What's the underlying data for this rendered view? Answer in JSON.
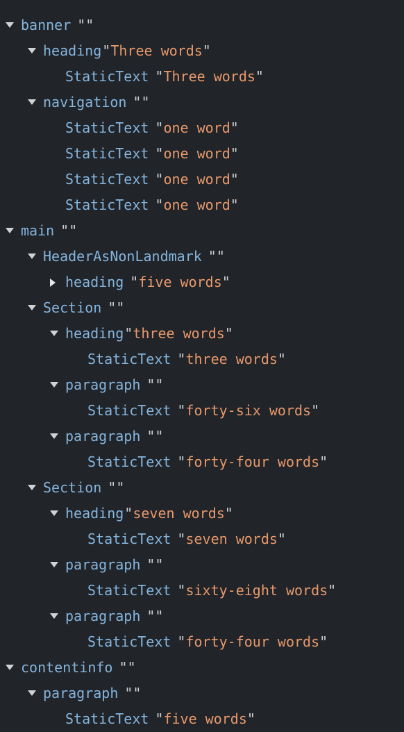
{
  "panel": {
    "name": "accessibility-tree",
    "title": "Accessibility Tree",
    "background_color": "#212429",
    "role_color": "#85b5dd",
    "value_color": "#e8996c",
    "quote_color": "#cdd0d3",
    "triangle_color": "#cfd3d6"
  },
  "quote": "\"",
  "nodes": [
    {
      "depth": 0,
      "marker": "none",
      "role": "",
      "value": "",
      "clipped": true
    },
    {
      "depth": 0,
      "marker": "open",
      "role": "banner",
      "value": ""
    },
    {
      "depth": 1,
      "marker": "open",
      "role": "heading",
      "value": "Three words"
    },
    {
      "depth": 2,
      "marker": "none",
      "role": "StaticText",
      "value": "Three words"
    },
    {
      "depth": 1,
      "marker": "open",
      "role": "navigation",
      "value": ""
    },
    {
      "depth": 2,
      "marker": "none",
      "role": "StaticText",
      "value": "one word"
    },
    {
      "depth": 2,
      "marker": "none",
      "role": "StaticText",
      "value": "one word"
    },
    {
      "depth": 2,
      "marker": "none",
      "role": "StaticText",
      "value": "one word"
    },
    {
      "depth": 2,
      "marker": "none",
      "role": "StaticText",
      "value": "one word"
    },
    {
      "depth": 0,
      "marker": "open",
      "role": "main",
      "value": ""
    },
    {
      "depth": 1,
      "marker": "open",
      "role": "HeaderAsNonLandmark",
      "value": ""
    },
    {
      "depth": 2,
      "marker": "closed",
      "role": "heading",
      "value": "five words"
    },
    {
      "depth": 1,
      "marker": "open",
      "role": "Section",
      "value": ""
    },
    {
      "depth": 2,
      "marker": "open",
      "role": "heading",
      "value": "three words"
    },
    {
      "depth": 3,
      "marker": "none",
      "role": "StaticText",
      "value": "three words"
    },
    {
      "depth": 2,
      "marker": "open",
      "role": "paragraph",
      "value": ""
    },
    {
      "depth": 3,
      "marker": "none",
      "role": "StaticText",
      "value": "forty-six words"
    },
    {
      "depth": 2,
      "marker": "open",
      "role": "paragraph",
      "value": ""
    },
    {
      "depth": 3,
      "marker": "none",
      "role": "StaticText",
      "value": "forty-four words"
    },
    {
      "depth": 1,
      "marker": "open",
      "role": "Section",
      "value": ""
    },
    {
      "depth": 2,
      "marker": "open",
      "role": "heading",
      "value": "seven words"
    },
    {
      "depth": 3,
      "marker": "none",
      "role": "StaticText",
      "value": "seven words"
    },
    {
      "depth": 2,
      "marker": "open",
      "role": "paragraph",
      "value": ""
    },
    {
      "depth": 3,
      "marker": "none",
      "role": "StaticText",
      "value": "sixty-eight words"
    },
    {
      "depth": 2,
      "marker": "open",
      "role": "paragraph",
      "value": ""
    },
    {
      "depth": 3,
      "marker": "none",
      "role": "StaticText",
      "value": "forty-four words"
    },
    {
      "depth": 0,
      "marker": "open",
      "role": "contentinfo",
      "value": ""
    },
    {
      "depth": 1,
      "marker": "open",
      "role": "paragraph",
      "value": ""
    },
    {
      "depth": 2,
      "marker": "none",
      "role": "StaticText",
      "value": "five words"
    }
  ]
}
